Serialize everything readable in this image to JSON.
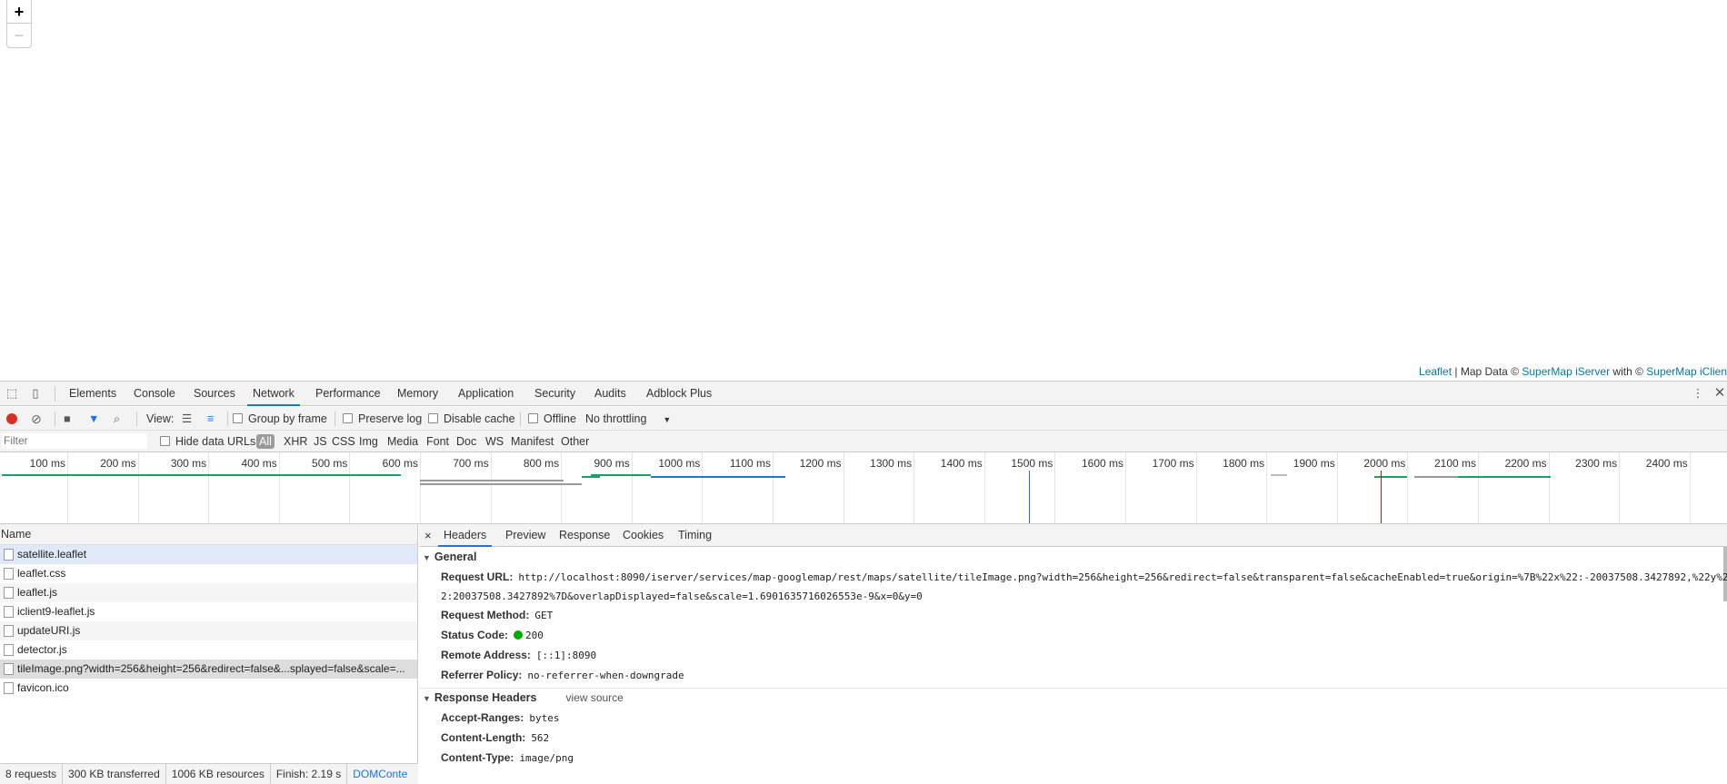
{
  "map": {
    "zoom_in": "+",
    "zoom_out": "−",
    "attribution": {
      "leaflet": "Leaflet",
      "sep": " | Map Data © ",
      "iserver": "SuperMap iServer",
      "with": " with © ",
      "iclient": "SuperMap iClien"
    }
  },
  "devtools": {
    "tabs": [
      "Elements",
      "Console",
      "Sources",
      "Network",
      "Performance",
      "Memory",
      "Application",
      "Security",
      "Audits",
      "Adblock Plus"
    ],
    "active_tab": "Network",
    "toolbar": {
      "view_label": "View:",
      "group_by_frame": "Group by frame",
      "preserve_log": "Preserve log",
      "disable_cache": "Disable cache",
      "offline": "Offline",
      "throttling": "No throttling"
    },
    "filterbar": {
      "placeholder": "Filter",
      "hide_data_urls": "Hide data URLs",
      "types": [
        "All",
        "XHR",
        "JS",
        "CSS",
        "Img",
        "Media",
        "Font",
        "Doc",
        "WS",
        "Manifest",
        "Other"
      ]
    },
    "timeline_ticks": [
      "100 ms",
      "200 ms",
      "300 ms",
      "400 ms",
      "500 ms",
      "600 ms",
      "700 ms",
      "800 ms",
      "900 ms",
      "1000 ms",
      "1100 ms",
      "1200 ms",
      "1300 ms",
      "1400 ms",
      "1500 ms",
      "1600 ms",
      "1700 ms",
      "1800 ms",
      "1900 ms",
      "2000 ms",
      "2100 ms",
      "2200 ms",
      "2300 ms",
      "2400 ms",
      "2"
    ],
    "requests": {
      "header": "Name",
      "items": [
        "satellite.leaflet",
        "leaflet.css",
        "leaflet.js",
        "iclient9-leaflet.js",
        "updateURI.js",
        "detector.js",
        "tileImage.png?width=256&height=256&redirect=false&...splayed=false&scale=...",
        "favicon.ico"
      ]
    },
    "status": {
      "requests": "8 requests",
      "transferred": "300 KB transferred",
      "resources": "1006 KB resources",
      "finish": "Finish: 2.19 s",
      "dom": "DOMConte"
    },
    "details": {
      "close": "×",
      "tabs": [
        "Headers",
        "Preview",
        "Response",
        "Cookies",
        "Timing"
      ],
      "general_title": "General",
      "request_url_label": "Request URL:",
      "request_url_1": "http://localhost:8090/iserver/services/map-googlemap/rest/maps/satellite/tileImage.png?width=256&height=256&redirect=false&transparent=false&cacheEnabled=true&origin=%7B%22x%22:-20037508.3427892,%22y%2",
      "request_url_2": "2:20037508.3427892%7D&overlapDisplayed=false&scale=1.6901635716026553e-9&x=0&y=0",
      "request_method_label": "Request Method:",
      "request_method": "GET",
      "status_code_label": "Status Code:",
      "status_code": "200",
      "remote_address_label": "Remote Address:",
      "remote_address": "[::1]:8090",
      "referrer_policy_label": "Referrer Policy:",
      "referrer_policy": "no-referrer-when-downgrade",
      "response_headers_title": "Response Headers",
      "view_source": "view source",
      "accept_ranges_label": "Accept-Ranges:",
      "accept_ranges": "bytes",
      "content_length_label": "Content-Length:",
      "content_length": "562",
      "content_type_label": "Content-Type:",
      "content_type": "image/png"
    }
  }
}
